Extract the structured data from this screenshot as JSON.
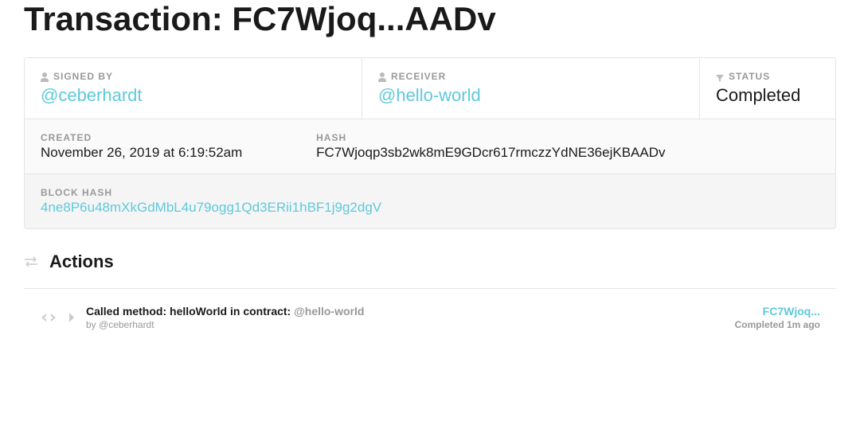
{
  "page": {
    "title_prefix": "Transaction: ",
    "title_hash": "FC7Wjoq...AADv"
  },
  "summary": {
    "signed_by": {
      "label": "SIGNED BY",
      "value": "@ceberhardt"
    },
    "receiver": {
      "label": "RECEIVER",
      "value": "@hello-world"
    },
    "status": {
      "label": "STATUS",
      "value": "Completed"
    },
    "created": {
      "label": "CREATED",
      "value": "November 26, 2019 at 6:19:52am"
    },
    "hash": {
      "label": "HASH",
      "value": "FC7Wjoqp3sb2wk8mE9GDcr617rmczzYdNE36ejKBAADv"
    },
    "block_hash": {
      "label": "BLOCK HASH",
      "value": "4ne8P6u48mXkGdMbL4u79ogg1Qd3ERii1hBF1j9g2dgV"
    }
  },
  "actions_section": {
    "title": "Actions"
  },
  "actions": [
    {
      "prefix": "Called method: ",
      "method": "helloWorld",
      "mid": " in contract: ",
      "contract": "@hello-world",
      "byline_prefix": "by ",
      "byline_user": "@ceberhardt",
      "right_link": "FC7Wjoq...",
      "right_status": "Completed 1m ago"
    }
  ]
}
